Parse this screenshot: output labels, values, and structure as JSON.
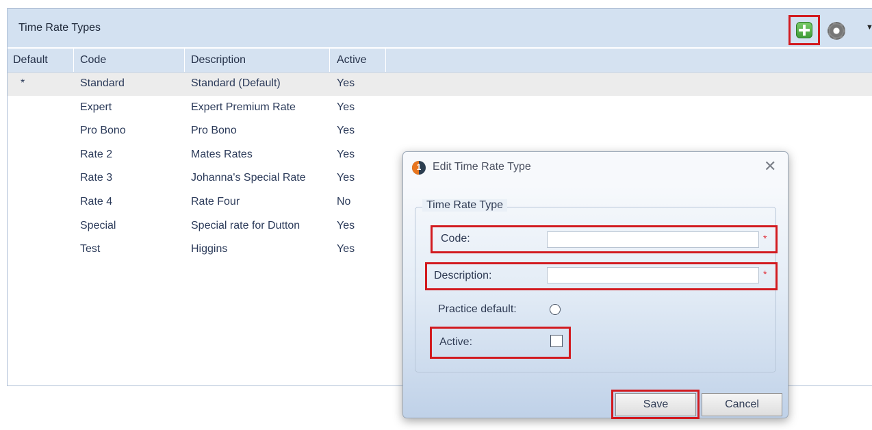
{
  "panel": {
    "title": "Time Rate Types",
    "toolbar": {
      "add_icon": "plus-square-icon",
      "settings_icon": "gear-icon",
      "menu_caret": "▼"
    }
  },
  "grid": {
    "columns": [
      "Default",
      "Code",
      "Description",
      "Active"
    ],
    "rows": [
      {
        "default": "*",
        "code": "Standard",
        "description": "Standard (Default)",
        "active": "Yes"
      },
      {
        "default": "",
        "code": "Expert",
        "description": "Expert Premium Rate",
        "active": "Yes"
      },
      {
        "default": "",
        "code": "Pro Bono",
        "description": "Pro Bono",
        "active": "Yes"
      },
      {
        "default": "",
        "code": "Rate 2",
        "description": "Mates Rates",
        "active": "Yes"
      },
      {
        "default": "",
        "code": "Rate 3",
        "description": "Johanna's Special Rate",
        "active": "Yes"
      },
      {
        "default": "",
        "code": "Rate 4",
        "description": "Rate Four",
        "active": "No"
      },
      {
        "default": "",
        "code": "Special",
        "description": "Special rate for Dutton",
        "active": "Yes"
      },
      {
        "default": "",
        "code": "Test",
        "description": "Higgins",
        "active": "Yes"
      }
    ]
  },
  "dialog": {
    "title": "Edit Time Rate Type",
    "logo_text": "1",
    "close_icon": "✕",
    "group_title": "Time Rate Type",
    "code": {
      "label": "Code:",
      "value": "",
      "required_mark": "*"
    },
    "description": {
      "label": "Description:",
      "value": "",
      "required_mark": "*"
    },
    "practice_default": {
      "label": "Practice default:",
      "checked": false
    },
    "active": {
      "label": "Active:",
      "checked": false
    },
    "save_label": "Save",
    "cancel_label": "Cancel"
  },
  "colors": {
    "highlight": "#d21a1f",
    "header_bg": "#d3e1f1",
    "selected_row": "#ececec"
  }
}
